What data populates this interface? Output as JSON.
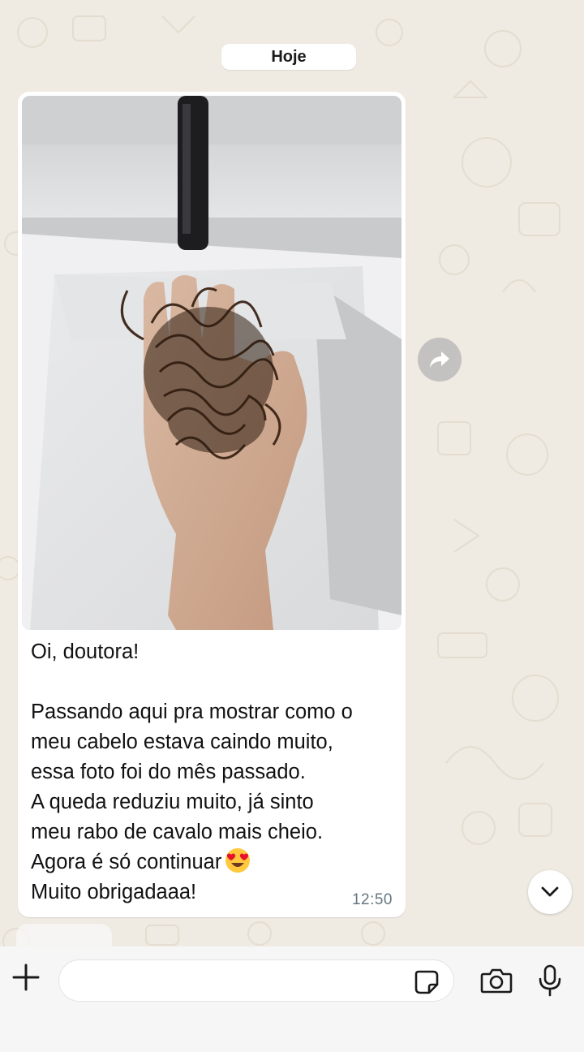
{
  "chat": {
    "date_separator": "Hoje",
    "message": {
      "caption_lines": [
        "Oi, doutora!",
        "",
        "Passando aqui pra mostrar como o",
        "meu cabelo estava caindo muito,",
        "essa foto foi do mês passado.",
        "A queda reduziu muito, já sinto",
        "meu rabo de cavalo mais cheio.",
        "Agora é só continuar",
        "Muito obrigadaaa!"
      ],
      "emoji": "heart-eyes-emoji",
      "time": "12:50"
    }
  },
  "composer": {
    "value": "",
    "placeholder": ""
  },
  "icons": {
    "forward": "forward-arrow-icon",
    "scroll_down": "chevron-down-icon",
    "attach": "plus-icon",
    "sticker": "sticker-icon",
    "camera": "camera-icon",
    "mic": "microphone-icon"
  },
  "colors": {
    "wallpaper": "#efeae2",
    "bubble": "#ffffff",
    "time": "#667781"
  }
}
